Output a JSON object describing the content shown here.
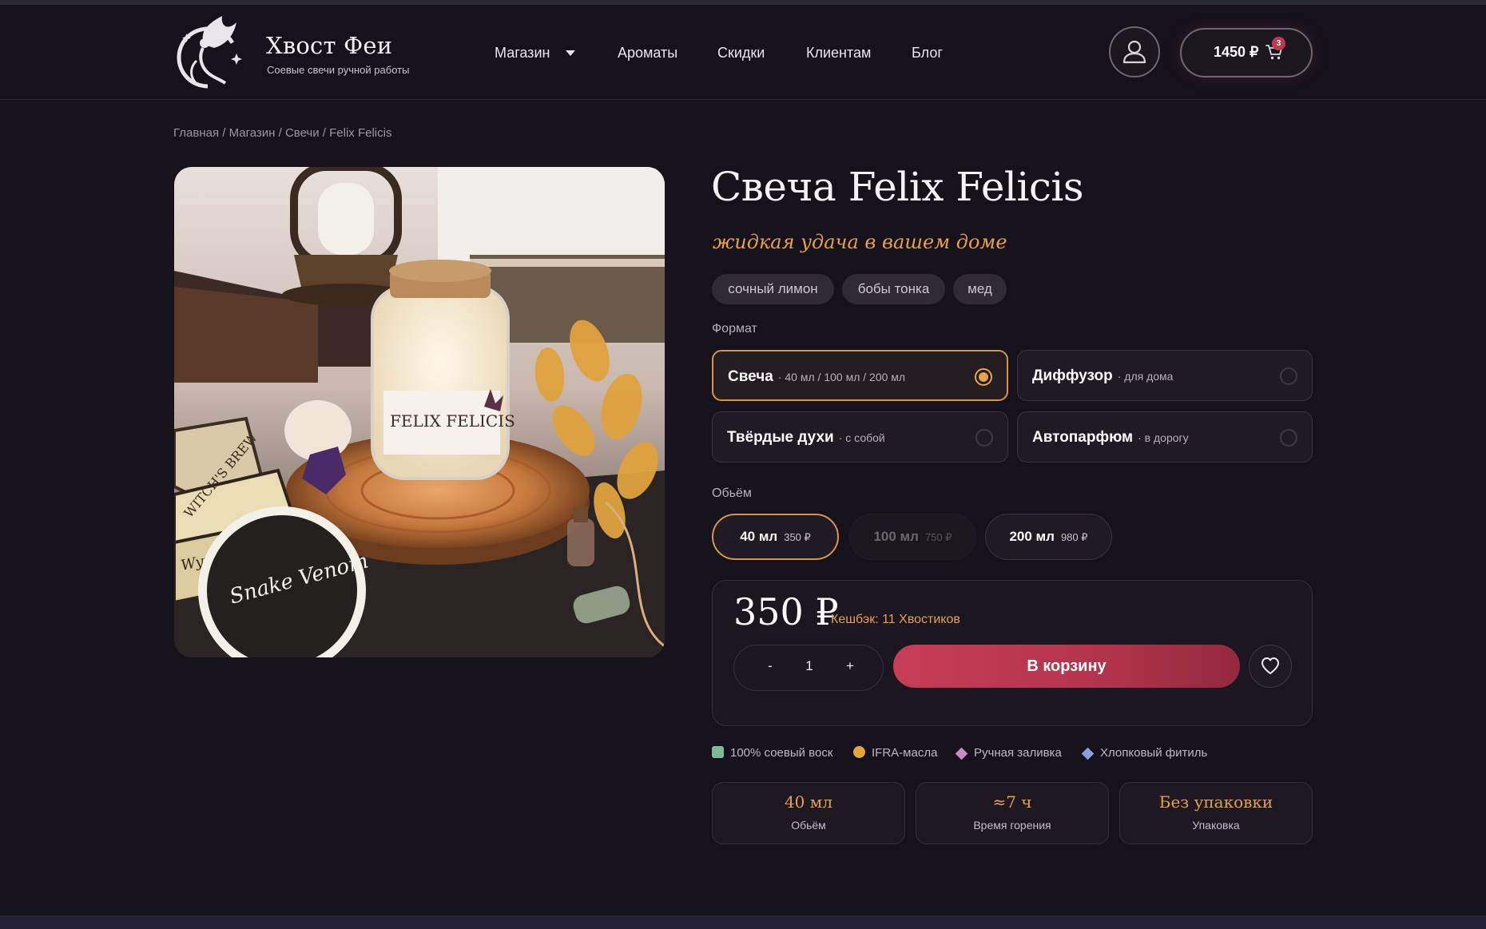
{
  "brand": {
    "name": "Хвост Феи",
    "tagline": "Соевые свечи ручной работы"
  },
  "nav": {
    "items": [
      {
        "label": "Магазин",
        "has_dropdown": true
      },
      {
        "label": "Ароматы"
      },
      {
        "label": "Скидки"
      },
      {
        "label": "Клиентам"
      },
      {
        "label": "Блог"
      }
    ]
  },
  "cart": {
    "total": "1450 ₽",
    "count": "3"
  },
  "breadcrumb": "Главная / Магазин / Свечи / Felix Felicis",
  "product": {
    "title": "Свеча Felix Felicis",
    "subtitle": "жидкая удача в вашем доме",
    "tags": [
      "сочный лимон",
      "бобы тонка",
      "мед"
    ],
    "image_labels": {
      "jar_label": "FELIX FELICIS",
      "sticker_venom": "Snake Venom",
      "sticker_brew": "WITCH'S BREW",
      "sticker_wyvern": "Wyvern Venom"
    }
  },
  "format": {
    "label": "Формат",
    "options": [
      {
        "name": "Свеча",
        "note": "· 40 мл / 100 мл / 200 мл",
        "selected": true
      },
      {
        "name": "Диффузор",
        "note": "· для дома",
        "selected": false
      },
      {
        "name": "Твёрдые духи",
        "note": "· с собой",
        "selected": false
      },
      {
        "name": "Автопарфюм",
        "note": "· в дорогу",
        "selected": false
      }
    ]
  },
  "volume": {
    "label": "Обьём",
    "options": [
      {
        "size": "40 мл",
        "price": "350 ₽",
        "state": "selected"
      },
      {
        "size": "100 мл",
        "price": "750 ₽",
        "state": "disabled"
      },
      {
        "size": "200 мл",
        "price": "980 ₽",
        "state": "available"
      }
    ]
  },
  "buy": {
    "price": "350 ₽",
    "cashback": "Кешбэк: 11 Хвостиков",
    "qty_minus": "-",
    "qty_value": "1",
    "qty_plus": "+",
    "add_label": "В корзину"
  },
  "features": [
    {
      "label": "100% соевый воск",
      "color": "#7fb89a",
      "shape": "square"
    },
    {
      "label": "IFRA-масла",
      "color": "#e3a63f",
      "shape": "circle"
    },
    {
      "label": "Ручная заливка",
      "color": "#c98bc1",
      "shape": "diamond"
    },
    {
      "label": "Хлопковый фитиль",
      "color": "#8c9ee0",
      "shape": "diamond"
    }
  ],
  "specs": [
    {
      "value": "40 мл",
      "label": "Обьём"
    },
    {
      "value": "≈7 ч",
      "label": "Время горения"
    },
    {
      "value": "Без упаковки",
      "label": "Упаковка"
    }
  ],
  "colors": {
    "accent": "#e7a049",
    "button": "#c73d56",
    "background": "#16121b"
  },
  "icons": {
    "account": "user-icon",
    "cart": "cart-icon",
    "wishlist": "heart-icon",
    "dropdown": "caret-down-icon",
    "logo": "fairy-logo"
  }
}
